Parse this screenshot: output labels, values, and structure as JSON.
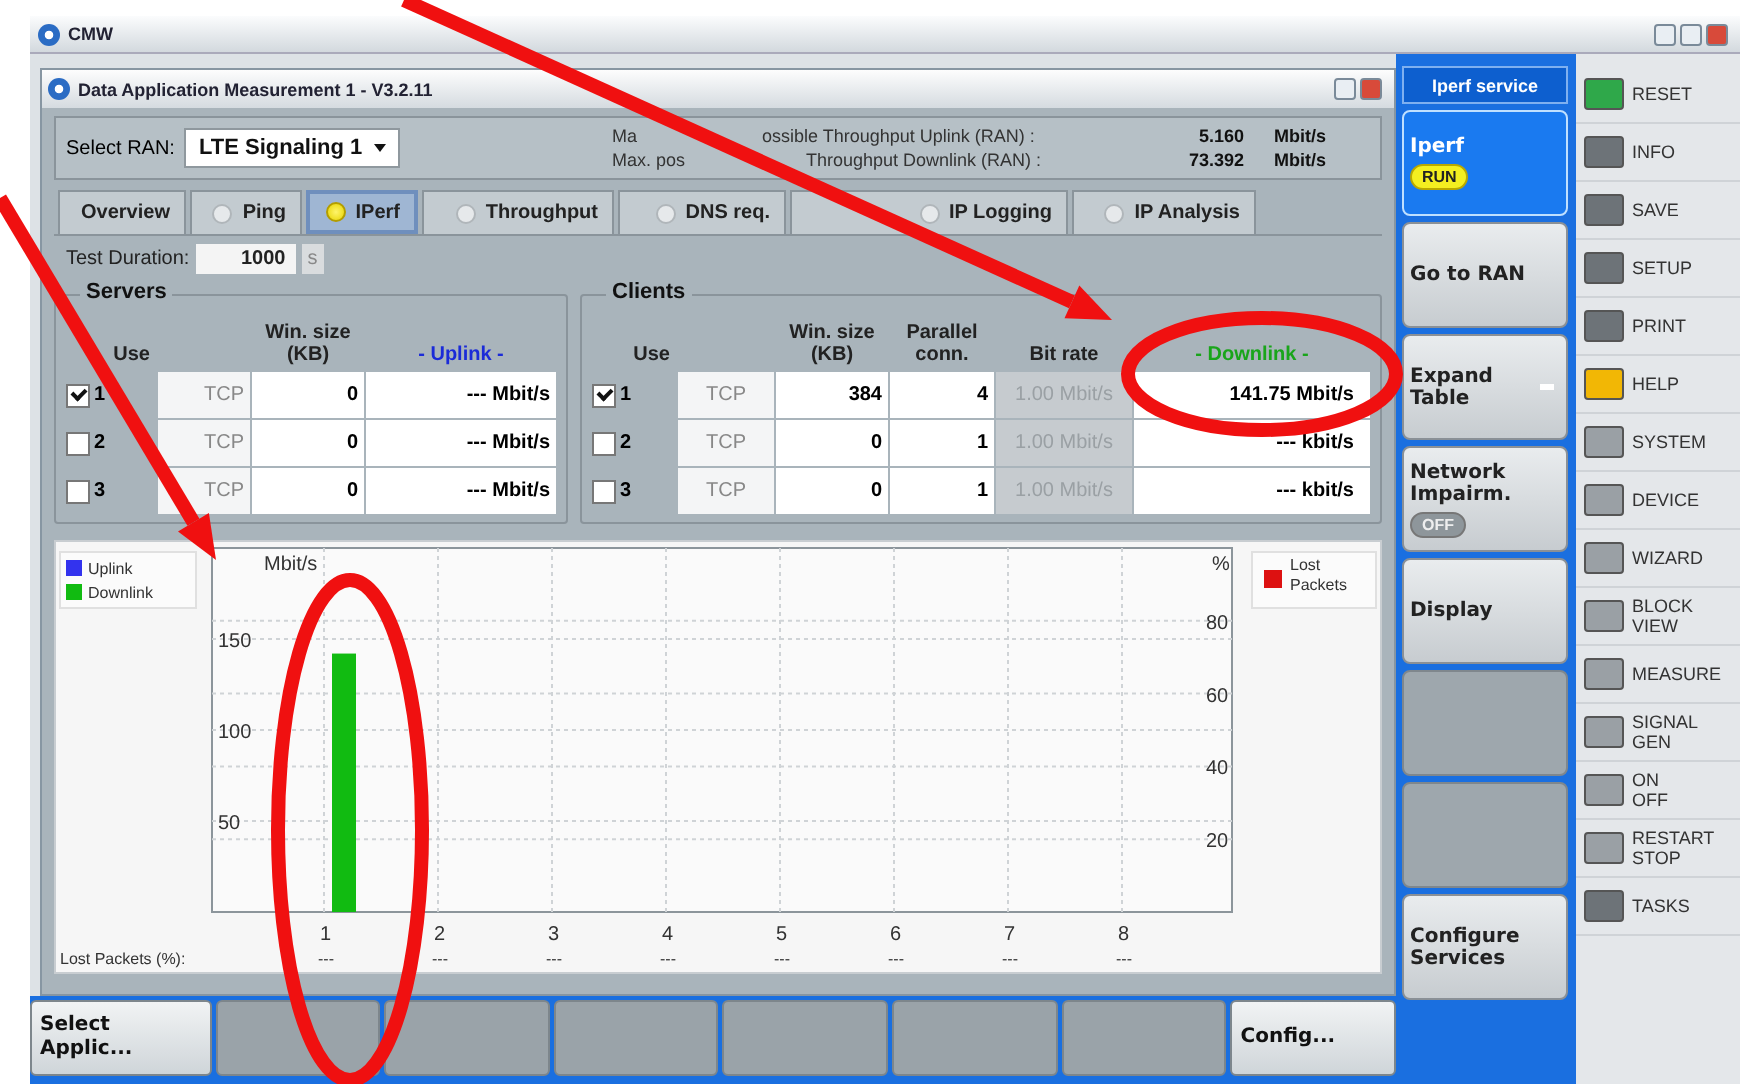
{
  "app_title": "CMW",
  "window": {
    "title": "Data Application Measurement 1 - V3.2.11"
  },
  "ran": {
    "label": "Select RAN:",
    "value": "LTE Signaling 1"
  },
  "max_throughput": [
    {
      "label_parts": [
        "Ma",
        "ossible Throughput Uplink (RAN) :"
      ],
      "value": "5.160",
      "unit": "Mbit/s"
    },
    {
      "label_parts": [
        "Max. pos",
        "Throughput Downlink (RAN) :"
      ],
      "value": "73.392",
      "unit": "Mbit/s"
    }
  ],
  "tabs": [
    {
      "label": "Overview",
      "kind": "plain",
      "selected": false
    },
    {
      "label": "Ping",
      "kind": "radio",
      "selected": false
    },
    {
      "label": "IPerf",
      "kind": "radio",
      "selected": true
    },
    {
      "label": "Throughput",
      "kind": "radio",
      "selected": false
    },
    {
      "label": "DNS req.",
      "kind": "radio",
      "selected": false
    },
    {
      "label": "IP Logging",
      "kind": "radio",
      "selected": false
    },
    {
      "label": "IP Analysis",
      "kind": "radio",
      "selected": false
    }
  ],
  "test_duration": {
    "label": "Test Duration:",
    "value": "1000",
    "unit": "s"
  },
  "servers": {
    "title": "Servers",
    "columns": [
      "Use",
      "Win. size (KB)",
      "- Uplink -"
    ],
    "rows": [
      {
        "checked": true,
        "number": "1",
        "protocol": "TCP",
        "win_size": "0",
        "rate": "--- Mbit/s"
      },
      {
        "checked": false,
        "number": "2",
        "protocol": "TCP",
        "win_size": "0",
        "rate": "--- Mbit/s"
      },
      {
        "checked": false,
        "number": "3",
        "protocol": "TCP",
        "win_size": "0",
        "rate": "--- Mbit/s"
      }
    ]
  },
  "clients": {
    "title": "Clients",
    "columns": [
      "Use",
      "Win. size (KB)",
      "Parallel conn.",
      "Bit rate",
      "- Downlink -"
    ],
    "rows": [
      {
        "checked": true,
        "number": "1",
        "protocol": "TCP",
        "win_size": "384",
        "parallel": "4",
        "bit_rate": "1.00 Mbit/s",
        "bit_rate_disabled": true,
        "rate": "141.75 Mbit/s"
      },
      {
        "checked": false,
        "number": "2",
        "protocol": "TCP",
        "win_size": "0",
        "parallel": "1",
        "bit_rate": "1.00 Mbit/s",
        "bit_rate_disabled": true,
        "rate": "--- kbit/s"
      },
      {
        "checked": false,
        "number": "3",
        "protocol": "TCP",
        "win_size": "0",
        "parallel": "1",
        "bit_rate": "1.00 Mbit/s",
        "bit_rate_disabled": true,
        "rate": "--- kbit/s"
      }
    ]
  },
  "chart": {
    "chart_data": {
      "type": "bar",
      "ylabel": "Mbit/s",
      "categories": [
        "1",
        "2",
        "3",
        "4",
        "5",
        "6",
        "7",
        "8"
      ],
      "ylim": [
        0,
        200
      ],
      "yticks": [
        50,
        100,
        150
      ],
      "grid": true,
      "series": [
        {
          "name": "Uplink",
          "color": "#3333ee",
          "values": [
            null,
            null,
            null,
            null,
            null,
            null,
            null,
            null
          ]
        },
        {
          "name": "Downlink",
          "color": "#11bb11",
          "values": [
            142,
            null,
            null,
            null,
            null,
            null,
            null,
            null
          ]
        }
      ]
    },
    "right_axis": {
      "label": "%",
      "ticks": [
        "80",
        "60",
        "40",
        "20"
      ]
    },
    "right_legend": {
      "name": "Lost Packets",
      "color": "#dd1111"
    },
    "lost_packets": {
      "label": "Lost Packets (%):",
      "values": [
        "---",
        "---",
        "---",
        "---",
        "---",
        "---",
        "---",
        "---"
      ]
    }
  },
  "bottom_softkeys": [
    {
      "kind": "key",
      "label": "Select Applic..."
    },
    {
      "kind": "blank"
    },
    {
      "kind": "blank"
    },
    {
      "kind": "blank"
    },
    {
      "kind": "blank"
    },
    {
      "kind": "blank"
    },
    {
      "kind": "blank"
    },
    {
      "kind": "key",
      "label": "Config..."
    }
  ],
  "softkeys_header": "Iperf service",
  "softkeys": [
    {
      "kind": "key",
      "label": "Iperf",
      "selected": true,
      "badge": {
        "label": "RUN",
        "on": true
      }
    },
    {
      "kind": "key",
      "label": "Go to RAN",
      "selected": false
    },
    {
      "kind": "key",
      "label": "Expand Table",
      "selected": false,
      "has_menu": true
    },
    {
      "kind": "key",
      "label": "Network Impairm.",
      "selected": false,
      "badge": {
        "label": "OFF",
        "on": false
      }
    },
    {
      "kind": "key",
      "label": "Display",
      "selected": false
    },
    {
      "kind": "blank"
    },
    {
      "kind": "blank"
    },
    {
      "kind": "key",
      "label": "Configure Services",
      "selected": false
    }
  ],
  "hardkeys": [
    {
      "label": "RESET",
      "color": "#2fa84a"
    },
    {
      "label": "INFO",
      "color": "#6d7378"
    },
    {
      "label": "SAVE",
      "color": "#6d7378"
    },
    {
      "label": "SETUP",
      "color": "#6d7378"
    },
    {
      "label": "PRINT",
      "color": "#6d7378"
    },
    {
      "label": "HELP",
      "color": "#f2b705"
    },
    {
      "label": "SYSTEM",
      "color": "#9aa0a5"
    },
    {
      "label": "DEVICE",
      "color": "#9aa0a5"
    },
    {
      "label": "WIZARD",
      "color": "#9aa0a5"
    },
    {
      "label": "BLOCK VIEW",
      "color": "#9aa0a5"
    },
    {
      "label": "MEASURE",
      "color": "#9aa0a5"
    },
    {
      "label": "SIGNAL GEN",
      "color": "#9aa0a5"
    },
    {
      "label": "ON OFF",
      "color": "#9aa0a5"
    },
    {
      "label": "RESTART STOP",
      "color": "#9aa0a5"
    },
    {
      "label": "TASKS",
      "color": "#6d7378"
    }
  ]
}
